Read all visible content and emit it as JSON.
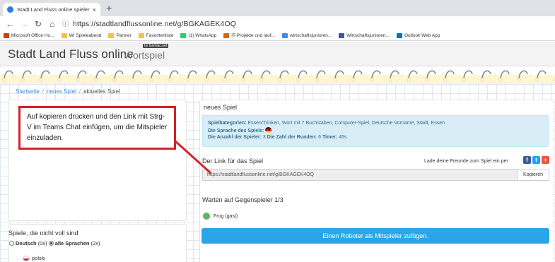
{
  "browser": {
    "tab_title": "Stadt Land Fluss online spielen",
    "tab_close": "×",
    "new_tab": "+",
    "url": "https://stadtlandflussonline.net/g/BGKAGEK4OQ",
    "bookmarks": [
      {
        "label": "Microsoft Office Ho...",
        "color": "#d83b01"
      },
      {
        "label": "WI Spieleabend",
        "color": "#f2c14e"
      },
      {
        "label": "Partner",
        "color": "#f2c14e"
      },
      {
        "label": "Favoritenliste",
        "color": "#f2c14e"
      },
      {
        "label": "(1) WhatsApp",
        "color": "#25d366"
      },
      {
        "label": "IT-Projekte und lauf...",
        "color": "#e36209"
      },
      {
        "label": "wirtschaftsjunioren...",
        "color": "#4285f4"
      },
      {
        "label": "Wirtschaftsjunioren...",
        "color": "#3b5998"
      },
      {
        "label": "Outlook Web App",
        "color": "#0072c6"
      }
    ]
  },
  "site": {
    "logo_main": "Stadt Land Fluss online",
    "logo_sub": "Wortspiel",
    "byline": "by Gamiac.net"
  },
  "breadcrumb": {
    "home": "Startseite",
    "new_game": "neues Spiel",
    "current": "aktuelles Spiel",
    "separator": "/"
  },
  "annotation": {
    "text": "Auf kopieren drücken und den Link mit Strg-V im Teams Chat einfügen, um die Mitspieler einzuladen."
  },
  "left_panel": {
    "title": "Spiele, die nicht voll sind",
    "option_deutsch": "Deutsch",
    "option_deutsch_count": "(0x)",
    "option_alle": "alle Sprachen",
    "option_alle_count": "(2x)",
    "language_polski": "polski"
  },
  "game": {
    "title": "neues Spiel",
    "categories_label": "Spielkategorien:",
    "categories_value": "Essen/Trinken, Wort mit 7 Buchstaben, Computer-Spiel, Deutsche Vorname, Stadt, Essen",
    "language_label": "Die Sprache des Spiels:",
    "players_label": "Die Anzahl der Spieler:",
    "players_value": "3",
    "rounds_label": "Die Zahl der Runden:",
    "rounds_value": "6",
    "timer_label": "Timer:",
    "timer_value": "45s",
    "link_label": "Der Link für das Spiel",
    "invite_label": "Lade deine Freunde zum Spiel ein per",
    "link_value": "https://stadtlandflussonline.net/g/BGKAGEK4OQ",
    "copy_button": "Kopieren",
    "waiting_label": "Warten auf Gegenspieler 1/3",
    "player_name": "Frog (gast)",
    "robot_button": "Einen Roboter als Mitspieler zufügen.",
    "share_fb": "f",
    "share_tw": "t",
    "share_gp": "+"
  }
}
